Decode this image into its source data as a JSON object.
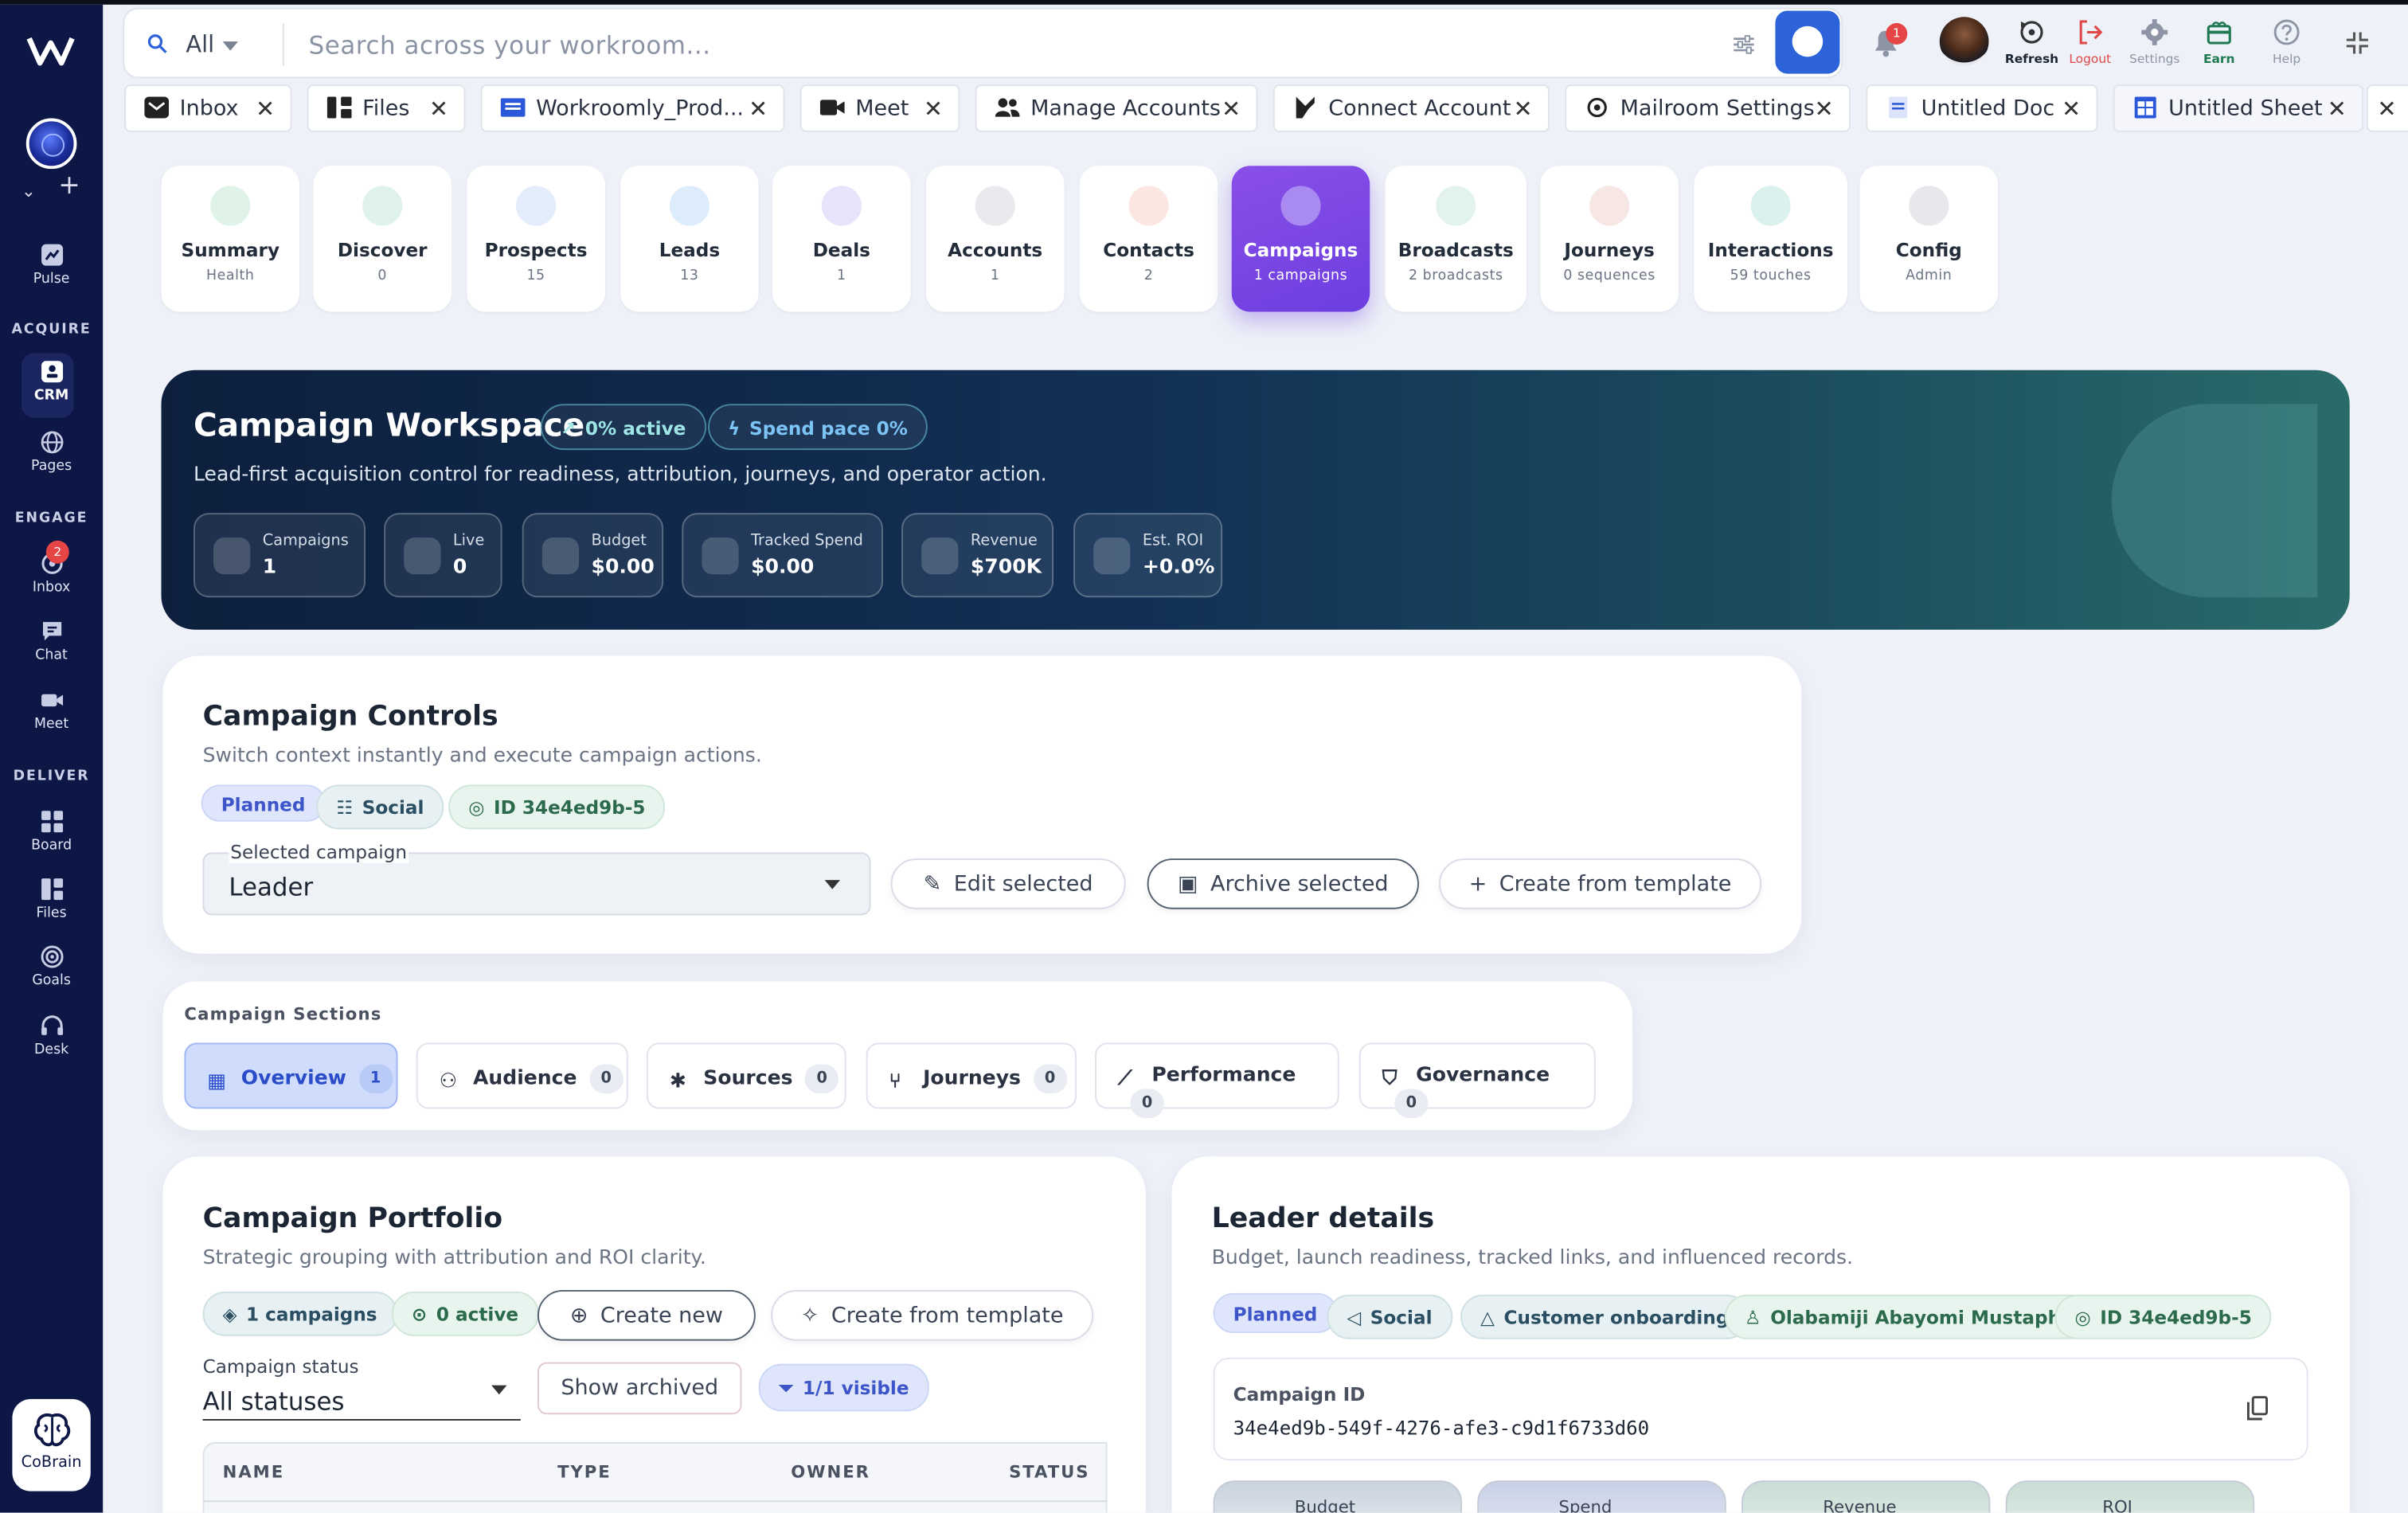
{
  "search": {
    "scope": "All",
    "placeholder": "Search across your workroom..."
  },
  "topbar": {
    "notifications": "1",
    "refresh": "Refresh",
    "logout": "Logout",
    "settings": "Settings",
    "earn": "Earn",
    "help": "Help"
  },
  "tabs": [
    "Inbox",
    "Files",
    "Workroomly_Prod...",
    "Meet",
    "Manage Accounts",
    "Connect Account",
    "Mailroom Settings",
    "Untitled Doc",
    "Untitled Sheet"
  ],
  "sidebar": {
    "pulse": "Pulse",
    "acquire": "ACQUIRE",
    "crm": "CRM",
    "pages": "Pages",
    "engage": "ENGAGE",
    "inbox": "Inbox",
    "inbox_badge": "2",
    "chat": "Chat",
    "meet": "Meet",
    "deliver": "DELIVER",
    "board": "Board",
    "files": "Files",
    "goals": "Goals",
    "desk": "Desk",
    "cobrain": "CoBrain"
  },
  "modules": [
    {
      "label": "Summary",
      "sub": "Health",
      "icon": "chart-icon",
      "color": "#dff3e8"
    },
    {
      "label": "Discover",
      "sub": "0",
      "icon": "compass-icon",
      "color": "#dff3ea"
    },
    {
      "label": "Prospects",
      "sub": "15",
      "icon": "user-icon",
      "color": "#e2ecfb"
    },
    {
      "label": "Leads",
      "sub": "13",
      "icon": "user-icon",
      "color": "#dcecfb"
    },
    {
      "label": "Deals",
      "sub": "1",
      "icon": "box-icon",
      "color": "#e6e4fa"
    },
    {
      "label": "Accounts",
      "sub": "1",
      "icon": "building-icon",
      "color": "#e8eaee"
    },
    {
      "label": "Contacts",
      "sub": "2",
      "icon": "people-icon",
      "color": "#fbe6e1"
    },
    {
      "label": "Campaigns",
      "sub": "1 campaigns",
      "icon": "megaphone-icon",
      "color": "#a98af0"
    },
    {
      "label": "Broadcasts",
      "sub": "2 broadcasts",
      "icon": "message-icon",
      "color": "#e2f3ee"
    },
    {
      "label": "Journeys",
      "sub": "0 sequences",
      "icon": "fork-icon",
      "color": "#f6e7e4"
    },
    {
      "label": "Interactions",
      "sub": "59 touches",
      "icon": "pulse-icon",
      "color": "#dbf1ee"
    },
    {
      "label": "Config",
      "sub": "Admin",
      "icon": "gear-icon",
      "color": "#e6e8ec"
    }
  ],
  "hero": {
    "title": "Campaign Workspace",
    "active": "0% active",
    "spend_pace": "Spend pace 0%",
    "subtitle": "Lead-first acquisition control for readiness, attribution, journeys, and operator action.",
    "stats": [
      {
        "label": "Campaigns",
        "value": "1"
      },
      {
        "label": "Live",
        "value": "0"
      },
      {
        "label": "Budget",
        "value": "$0.00"
      },
      {
        "label": "Tracked Spend",
        "value": "$0.00"
      },
      {
        "label": "Revenue",
        "value": "$700K"
      },
      {
        "label": "Est. ROI",
        "value": "+0.0%"
      }
    ]
  },
  "controls": {
    "title": "Campaign Controls",
    "subtitle": "Switch context instantly and execute campaign actions.",
    "chips": [
      "Planned",
      "Social",
      "ID 34e4ed9b-5"
    ],
    "select_label": "Selected campaign",
    "select_value": "Leader",
    "edit": "Edit selected",
    "archive": "Archive selected",
    "template": "Create from template"
  },
  "sections": {
    "title": "Campaign Sections",
    "tabs": [
      {
        "label": "Overview",
        "count": "1"
      },
      {
        "label": "Audience",
        "count": "0"
      },
      {
        "label": "Sources",
        "count": "0"
      },
      {
        "label": "Journeys",
        "count": "0"
      },
      {
        "label": "Performance",
        "count": "0"
      },
      {
        "label": "Governance",
        "count": "0"
      }
    ]
  },
  "portfolio": {
    "title": "Campaign Portfolio",
    "subtitle": "Strategic grouping with attribution and ROI clarity.",
    "campaigns_chip": "1 campaigns",
    "active_chip": "0 active",
    "create_new": "Create new",
    "template": "Create from template",
    "status_label": "Campaign status",
    "status_value": "All statuses",
    "show_archived": "Show archived",
    "visible": "1/1 visible",
    "columns": [
      "NAME",
      "TYPE",
      "OWNER",
      "STATUS"
    ]
  },
  "details": {
    "title": "Leader details",
    "subtitle": "Budget, launch readiness, tracked links, and influenced records.",
    "chips": [
      "Planned",
      "Social",
      "Customer onboarding",
      "Olabamiji Abayomi Mustapha",
      "ID 34e4ed9b-5"
    ],
    "id_label": "Campaign ID",
    "id_value": "34e4ed9b-549f-4276-afe3-c9d1f6733d60",
    "metrics": [
      "Budget",
      "Spend",
      "Revenue",
      "ROI"
    ]
  }
}
